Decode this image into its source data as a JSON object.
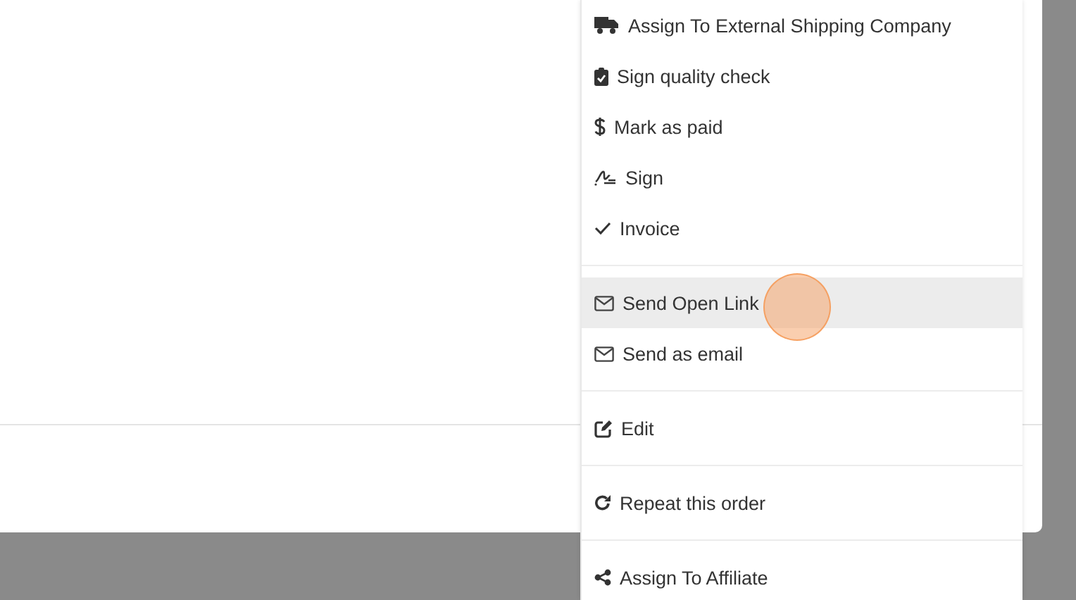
{
  "menu": {
    "groups": [
      [
        {
          "label": "Assign To External Shipping Company",
          "selected": false
        },
        {
          "label": "Sign quality check",
          "selected": false
        },
        {
          "label": "Mark as paid",
          "selected": false
        },
        {
          "label": "Sign",
          "selected": false
        },
        {
          "label": "Invoice",
          "selected": false
        }
      ],
      [
        {
          "label": "Send Open Link",
          "selected": true
        },
        {
          "label": "Send as email",
          "selected": false
        }
      ],
      [
        {
          "label": "Edit",
          "selected": false
        }
      ],
      [
        {
          "label": "Repeat this order",
          "selected": false
        }
      ],
      [
        {
          "label": "Assign To Affiliate",
          "selected": false
        }
      ]
    ]
  }
}
